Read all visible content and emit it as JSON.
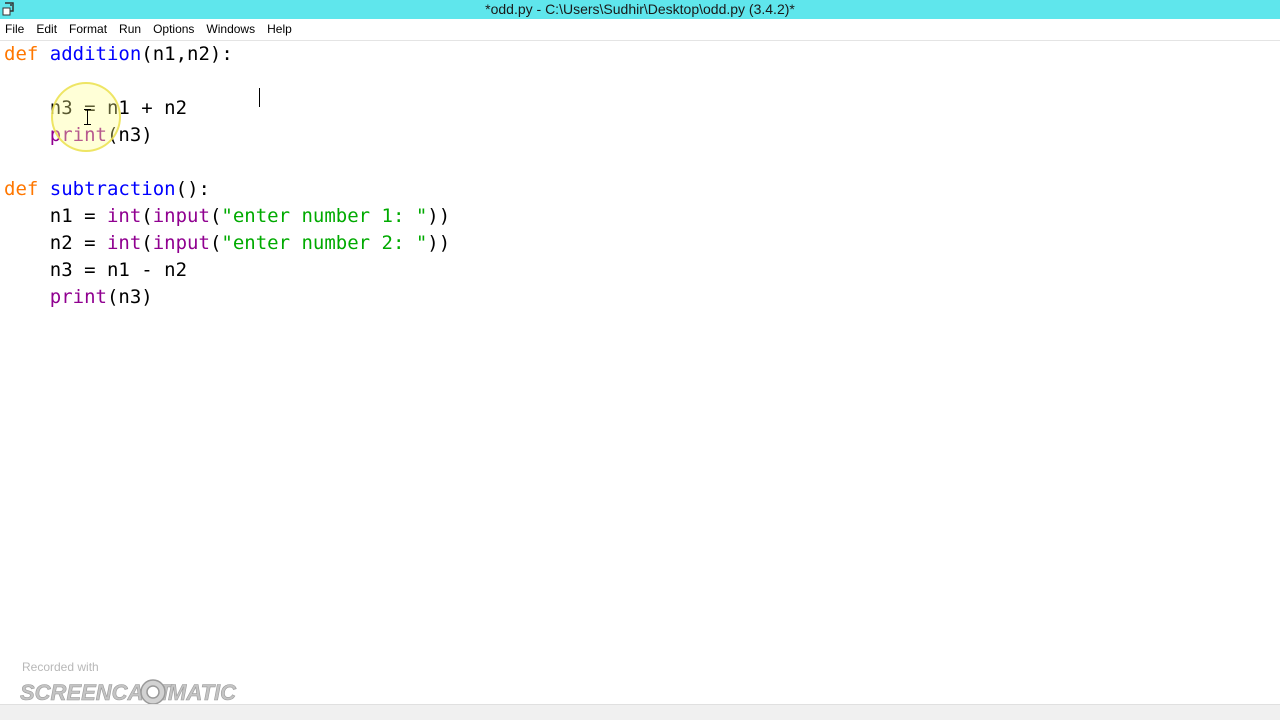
{
  "window": {
    "title": "*odd.py - C:\\Users\\Sudhir\\Desktop\\odd.py (3.4.2)*"
  },
  "menu": [
    {
      "label": "File"
    },
    {
      "label": "Edit"
    },
    {
      "label": "Format"
    },
    {
      "label": "Run"
    },
    {
      "label": "Options"
    },
    {
      "label": "Windows"
    },
    {
      "label": "Help"
    }
  ],
  "code": {
    "lines": [
      {
        "segments": [
          {
            "t": "def",
            "c": "kw"
          },
          {
            "t": " "
          },
          {
            "t": "addition",
            "c": "def"
          },
          {
            "t": "(n1,n2):"
          }
        ]
      },
      {
        "segments": []
      },
      {
        "segments": [
          {
            "t": "    n3 = n1 + n2"
          }
        ]
      },
      {
        "segments": [
          {
            "t": "    "
          },
          {
            "t": "print",
            "c": "bi"
          },
          {
            "t": "(n3)"
          }
        ]
      },
      {
        "segments": []
      },
      {
        "segments": [
          {
            "t": "def",
            "c": "kw"
          },
          {
            "t": " "
          },
          {
            "t": "subtraction",
            "c": "def"
          },
          {
            "t": "():"
          }
        ]
      },
      {
        "segments": [
          {
            "t": "    n1 = "
          },
          {
            "t": "int",
            "c": "bi"
          },
          {
            "t": "("
          },
          {
            "t": "input",
            "c": "bi"
          },
          {
            "t": "("
          },
          {
            "t": "\"enter number 1: \"",
            "c": "str"
          },
          {
            "t": "))"
          }
        ]
      },
      {
        "segments": [
          {
            "t": "    n2 = "
          },
          {
            "t": "int",
            "c": "bi"
          },
          {
            "t": "("
          },
          {
            "t": "input",
            "c": "bi"
          },
          {
            "t": "("
          },
          {
            "t": "\"enter number 2: \"",
            "c": "str"
          },
          {
            "t": "))"
          }
        ]
      },
      {
        "segments": [
          {
            "t": "    n3 = n1 - n2"
          }
        ]
      },
      {
        "segments": [
          {
            "t": "    "
          },
          {
            "t": "print",
            "c": "bi"
          },
          {
            "t": "(n3)"
          }
        ]
      }
    ]
  },
  "watermark": {
    "small_text": "Recorded with",
    "logo_text_left": "SCREENCAST",
    "logo_text_right": "MATIC"
  },
  "colors": {
    "titlebar": "#5fe6ec",
    "keyword": "#ff7700",
    "definition": "#0000ff",
    "builtin": "#900090",
    "string": "#00aa00"
  },
  "icons": {
    "app": "python-idle-icon",
    "cursor": "ibeam-cursor-icon"
  }
}
